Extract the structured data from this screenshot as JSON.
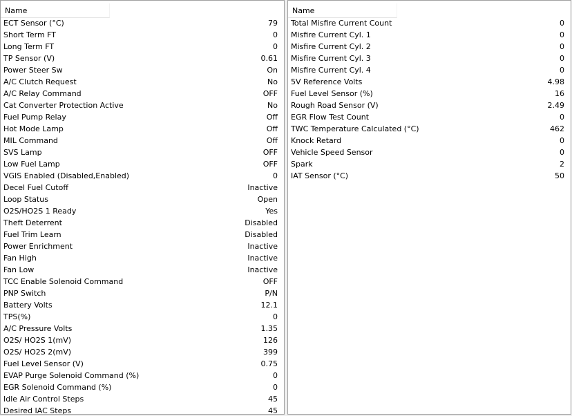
{
  "left_panel": {
    "header": "Name",
    "rows": [
      {
        "name": "ECT Sensor (°C)",
        "value": "79"
      },
      {
        "name": "Short Term FT",
        "value": "0"
      },
      {
        "name": "Long Term FT",
        "value": "0"
      },
      {
        "name": "TP Sensor (V)",
        "value": "0.61"
      },
      {
        "name": "Power Steer Sw",
        "value": "On"
      },
      {
        "name": "A/C Clutch Request",
        "value": "No"
      },
      {
        "name": "A/C Relay Command",
        "value": "OFF"
      },
      {
        "name": "Cat Converter Protection Active",
        "value": "No"
      },
      {
        "name": "Fuel Pump Relay",
        "value": "Off"
      },
      {
        "name": "Hot Mode Lamp",
        "value": "Off"
      },
      {
        "name": "MIL Command",
        "value": "Off"
      },
      {
        "name": "SVS Lamp",
        "value": "OFF"
      },
      {
        "name": "Low Fuel Lamp",
        "value": "OFF"
      },
      {
        "name": "VGIS Enabled (Disabled,Enabled)",
        "value": "0"
      },
      {
        "name": "Decel Fuel Cutoff",
        "value": "Inactive"
      },
      {
        "name": "Loop Status",
        "value": "Open"
      },
      {
        "name": "O2S/HO2S 1 Ready",
        "value": "Yes"
      },
      {
        "name": "Theft Deterrent",
        "value": "Disabled"
      },
      {
        "name": "Fuel Trim Learn",
        "value": "Disabled"
      },
      {
        "name": "Power Enrichment",
        "value": "Inactive"
      },
      {
        "name": "Fan High",
        "value": "Inactive"
      },
      {
        "name": "Fan Low",
        "value": "Inactive"
      },
      {
        "name": "TCC Enable Solenoid Command",
        "value": "OFF"
      },
      {
        "name": "PNP Switch",
        "value": "P/N"
      },
      {
        "name": "Battery Volts",
        "value": "12.1"
      },
      {
        "name": "TPS(%)",
        "value": "0"
      },
      {
        "name": "A/C Pressure Volts",
        "value": "1.35"
      },
      {
        "name": "O2S/ HO2S 1(mV)",
        "value": "126"
      },
      {
        "name": "O2S/ HO2S 2(mV)",
        "value": "399"
      },
      {
        "name": "Fuel Level Sensor (V)",
        "value": "0.75"
      },
      {
        "name": "EVAP Purge Solenoid Command (%)",
        "value": "0"
      },
      {
        "name": "EGR Solenoid Command (%)",
        "value": "0"
      },
      {
        "name": "Idle Air Control Steps",
        "value": "45"
      },
      {
        "name": "Desired IAC Steps",
        "value": "45"
      }
    ]
  },
  "right_panel": {
    "header": "Name",
    "rows": [
      {
        "name": "Total Misfire Current Count",
        "value": "0"
      },
      {
        "name": "Misfire Current Cyl. 1",
        "value": "0"
      },
      {
        "name": "Misfire Current Cyl. 2",
        "value": "0"
      },
      {
        "name": "Misfire Current Cyl. 3",
        "value": "0"
      },
      {
        "name": "Misfire Current Cyl. 4",
        "value": "0"
      },
      {
        "name": "5V Reference Volts",
        "value": "4.98"
      },
      {
        "name": "Fuel Level Sensor (%)",
        "value": "16"
      },
      {
        "name": "Rough Road Sensor (V)",
        "value": "2.49"
      },
      {
        "name": "EGR Flow Test Count",
        "value": "0"
      },
      {
        "name": "TWC Temperature Calculated (°C)",
        "value": "462"
      },
      {
        "name": "Knock Retard",
        "value": "0"
      },
      {
        "name": "Vehicle Speed Sensor",
        "value": "0"
      },
      {
        "name": "Spark",
        "value": "2"
      },
      {
        "name": "IAT Sensor (°C)",
        "value": "50"
      }
    ]
  }
}
